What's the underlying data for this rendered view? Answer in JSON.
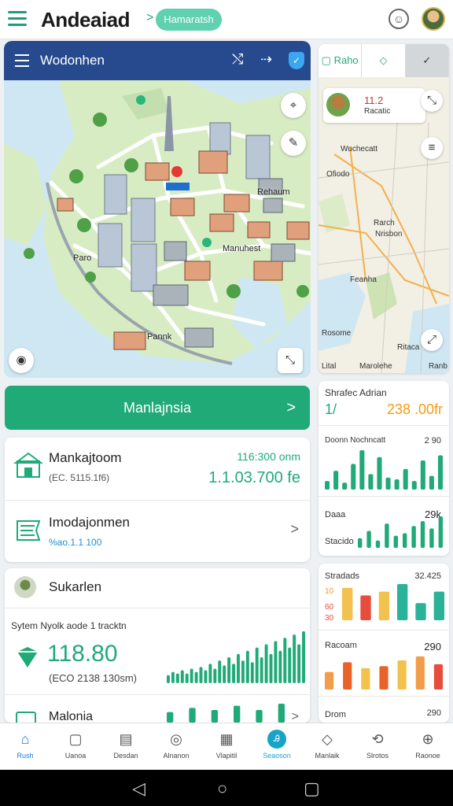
{
  "app": {
    "title": "Andeaiad",
    "chevron": ">",
    "pill_label": "Hamaratsh",
    "smile_icon": "smile-icon",
    "avatar": "user-avatar"
  },
  "map": {
    "header_title": "Wodonhen",
    "labels": {
      "rehaum": "Rehaum",
      "manuhest": "Manuhest",
      "pannk": "Pannk",
      "paro": "Paro"
    }
  },
  "right_map": {
    "tabs": [
      "Raho",
      "",
      ""
    ],
    "info_value": "11.2",
    "info_sub": "Racatic",
    "labels": [
      "Wuchecatt",
      "Ofiodo",
      "Rarch",
      "Nrisbon",
      "Feanha",
      "Rosome",
      "Ritaca"
    ],
    "bottom_labels": [
      "Lital",
      "Marolehe",
      "Ranb"
    ]
  },
  "action_button": {
    "label": "Manlajnsia",
    "arrow": ">"
  },
  "list_card": {
    "row1": {
      "title": "Mankajtoom",
      "sub": "(EC. 5115.1f6)",
      "value_top": "116:300 onm",
      "value_big": "1.1.03.700 fe"
    },
    "row2": {
      "title": "Imodajonmen",
      "sub": "%ao.1.1 100",
      "arrow": ">"
    }
  },
  "summary_card": {
    "title": "Sukarlen",
    "header_line": "Sytem   Nyolk aode   1 tracktn",
    "value": "118.80",
    "sub": "(ECO 2138 130sm)",
    "bottom_title": "Malonia",
    "arrow": ">",
    "bars": [
      5,
      7,
      6,
      8,
      6,
      9,
      7,
      10,
      8,
      12,
      9,
      14,
      11,
      16,
      12,
      18,
      14,
      20,
      13,
      22,
      16,
      24,
      18,
      26,
      20,
      28,
      22,
      30,
      24,
      32
    ]
  },
  "rpanel1": {
    "title": "Shrafec Adrian",
    "big_left": "1/",
    "big_right": "238 .00fr",
    "row_label": "Doonn Nochncatt",
    "row_value": "2 90",
    "bars": [
      10,
      22,
      8,
      30,
      46,
      18,
      38,
      14,
      12,
      24,
      10,
      34,
      16,
      40
    ],
    "sub_label1": "Daaa",
    "sub_value": "29k",
    "sub_label2": "Stacido",
    "bars2": [
      8,
      14,
      6,
      20,
      10,
      12,
      18,
      22,
      16,
      26
    ]
  },
  "rpanel2": {
    "title": "Stradads",
    "value": "32.425",
    "side_nums": [
      "10",
      "60",
      "30"
    ],
    "bars": [
      {
        "v": 34,
        "c": "#f2c14e"
      },
      {
        "v": 26,
        "c": "#e74c3c"
      },
      {
        "v": 30,
        "c": "#f2c14e"
      },
      {
        "v": 38,
        "c": "#2bb39a"
      },
      {
        "v": 18,
        "c": "#2bb39a"
      },
      {
        "v": 30,
        "c": "#2bb39a"
      }
    ],
    "label2": "Racoam",
    "value2": "290",
    "bars2": [
      {
        "v": 18,
        "c": "#f39c4a"
      },
      {
        "v": 28,
        "c": "#e8622a"
      },
      {
        "v": 22,
        "c": "#f2c14e"
      },
      {
        "v": 24,
        "c": "#e8622a"
      },
      {
        "v": 30,
        "c": "#f2c14e"
      },
      {
        "v": 34,
        "c": "#f39c4a"
      },
      {
        "v": 26,
        "c": "#e74c3c"
      }
    ],
    "label3": "Drom",
    "value3": "290"
  },
  "bottom_nav": [
    {
      "label": "Rush",
      "icon": "home-icon",
      "glyph": "⌂"
    },
    {
      "label": "Uanoa",
      "icon": "bookmark-icon",
      "glyph": "▢"
    },
    {
      "label": "Desdan",
      "icon": "building-icon",
      "glyph": "▤"
    },
    {
      "label": "Alnanon",
      "icon": "globe-icon",
      "glyph": "◎"
    },
    {
      "label": "Vlapitil",
      "icon": "document-icon",
      "glyph": "▦"
    },
    {
      "label": "Seaoson",
      "icon": "search-icon",
      "glyph": "Ꭿ"
    },
    {
      "label": "Manlaik",
      "icon": "diamond-icon",
      "glyph": "◇"
    },
    {
      "label": "Slrotos",
      "icon": "route-icon",
      "glyph": "⟲"
    },
    {
      "label": "Raonoe",
      "icon": "lock-icon",
      "glyph": "⊕"
    }
  ],
  "system_bar": {
    "back": "◁",
    "home": "○",
    "recents": "▢"
  }
}
